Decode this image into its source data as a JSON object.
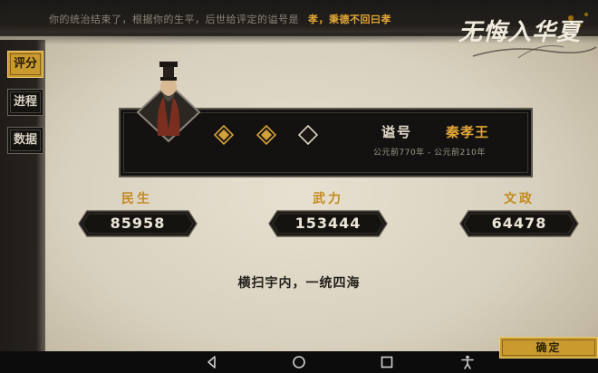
{
  "header": {
    "message": "你的统治结束了，根据你的生平，后世给评定的谥号是",
    "posthumous_phrase": "孝，秉德不回曰孝"
  },
  "logo": {
    "text": "无悔入华夏"
  },
  "sidebar": {
    "items": [
      {
        "label": "评分",
        "active": true
      },
      {
        "label": "进程",
        "active": false
      },
      {
        "label": "数据",
        "active": false
      }
    ]
  },
  "ruler": {
    "title_label": "谥号",
    "title_value": "秦孝王",
    "date_range": "公元前770年 - 公元前210年",
    "diamonds": [
      {
        "state": "filled"
      },
      {
        "state": "filled"
      },
      {
        "state": "empty"
      }
    ]
  },
  "stats": [
    {
      "label": "民生",
      "value": "85958"
    },
    {
      "label": "武力",
      "value": "153444"
    },
    {
      "label": "文政",
      "value": "64478"
    }
  ],
  "motto": "横扫宇内，一统四海",
  "confirm_label": "确定",
  "colors": {
    "gold": "#e2a638",
    "button_gold": "#c99a2e",
    "panel_dark": "#141210",
    "parchment": "#e7e0d0"
  },
  "navbar": {
    "icons": [
      "back-icon",
      "home-icon",
      "recents-icon",
      "accessibility-icon"
    ]
  }
}
